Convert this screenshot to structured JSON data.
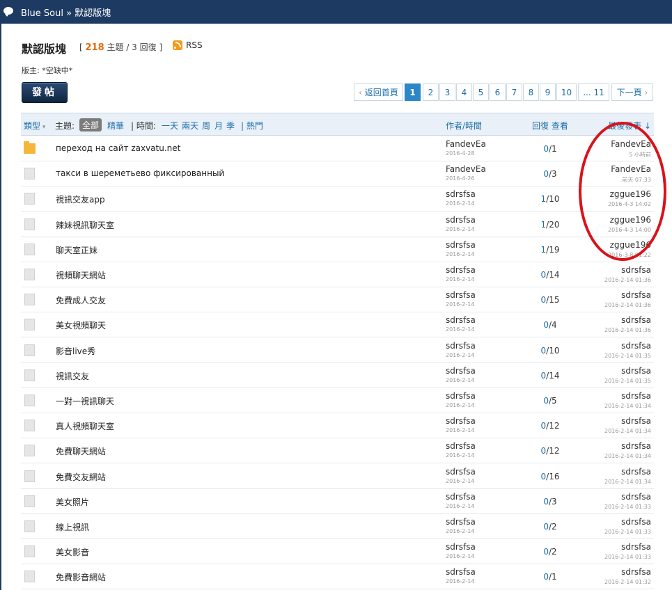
{
  "breadcrumb": {
    "site": "Blue Soul",
    "sep": "»",
    "forum": "默認版塊"
  },
  "forum": {
    "title": "默認版塊",
    "threads": "218",
    "threads_label": "主題",
    "replies": "/ 3 回復",
    "open": "[",
    "close": "]",
    "rss": "RSS"
  },
  "moderator": "版主: *空缺中*",
  "post_button": "發帖",
  "pager": {
    "prev": "返回首頁",
    "pages": [
      "1",
      "2",
      "3",
      "4",
      "5",
      "6",
      "7",
      "8",
      "9",
      "10"
    ],
    "last": "... 11",
    "next": "下一頁",
    "current": "1"
  },
  "header": {
    "type": "類型",
    "subject": "主題:",
    "all": "全部",
    "digest": "精華",
    "time": "| 時間:",
    "day": "一天",
    "two_days": "兩天",
    "week": "周",
    "month": "月",
    "season": "季",
    "hot": "| 熱門",
    "author": "作者/時間",
    "replies_views": "回復 查看",
    "lastpost": "最後發表 ↓"
  },
  "threads": [
    {
      "icon": "folder",
      "subject": "переход на сайт zaxvatu.net",
      "author": "FandevEa",
      "date": "2016-4-28",
      "replies": "0",
      "views": "1",
      "last_user": "FandevEa",
      "last_time": "5 小時前"
    },
    {
      "icon": "file",
      "subject": "такси в шереметьево фиксированный",
      "author": "FandevEa",
      "date": "2016-4-26",
      "replies": "0",
      "views": "3",
      "last_user": "FandevEa",
      "last_time": "前天 07:33"
    },
    {
      "icon": "file",
      "subject": "視訊交友app",
      "author": "sdrsfsa",
      "date": "2016-2-14",
      "replies": "1",
      "views": "10",
      "last_user": "zggue196",
      "last_time": "2016-4-3 14:02"
    },
    {
      "icon": "file",
      "subject": "辣妹視訊聊天室",
      "author": "sdrsfsa",
      "date": "2016-2-14",
      "replies": "1",
      "views": "20",
      "last_user": "zggue196",
      "last_time": "2016-4-3 14:00"
    },
    {
      "icon": "file",
      "subject": "聊天室正妹",
      "author": "sdrsfsa",
      "date": "2016-2-14",
      "replies": "1",
      "views": "19",
      "last_user": "zggue196",
      "last_time": "2016-3-8 01:22"
    },
    {
      "icon": "file",
      "subject": "視頻聊天網站",
      "author": "sdrsfsa",
      "date": "2016-2-14",
      "replies": "0",
      "views": "14",
      "last_user": "sdrsfsa",
      "last_time": "2016-2-14 01:36"
    },
    {
      "icon": "file",
      "subject": "免費成人交友",
      "author": "sdrsfsa",
      "date": "2016-2-14",
      "replies": "0",
      "views": "15",
      "last_user": "sdrsfsa",
      "last_time": "2016-2-14 01:36"
    },
    {
      "icon": "file",
      "subject": "美女視頻聊天",
      "author": "sdrsfsa",
      "date": "2016-2-14",
      "replies": "0",
      "views": "4",
      "last_user": "sdrsfsa",
      "last_time": "2016-2-14 01:36"
    },
    {
      "icon": "file",
      "subject": "影音live秀",
      "author": "sdrsfsa",
      "date": "2016-2-14",
      "replies": "0",
      "views": "10",
      "last_user": "sdrsfsa",
      "last_time": "2016-2-14 01:35"
    },
    {
      "icon": "file",
      "subject": "視訊交友",
      "author": "sdrsfsa",
      "date": "2016-2-14",
      "replies": "0",
      "views": "14",
      "last_user": "sdrsfsa",
      "last_time": "2016-2-14 01:35"
    },
    {
      "icon": "file",
      "subject": "一對一視訊聊天",
      "author": "sdrsfsa",
      "date": "2016-2-14",
      "replies": "0",
      "views": "5",
      "last_user": "sdrsfsa",
      "last_time": "2016-2-14 01:34"
    },
    {
      "icon": "file",
      "subject": "真人視頻聊天室",
      "author": "sdrsfsa",
      "date": "2016-2-14",
      "replies": "0",
      "views": "12",
      "last_user": "sdrsfsa",
      "last_time": "2016-2-14 01:34"
    },
    {
      "icon": "file",
      "subject": "免費聊天網站",
      "author": "sdrsfsa",
      "date": "2016-2-14",
      "replies": "0",
      "views": "12",
      "last_user": "sdrsfsa",
      "last_time": "2016-2-14 01:34"
    },
    {
      "icon": "file",
      "subject": "免費交友網站",
      "author": "sdrsfsa",
      "date": "2016-2-14",
      "replies": "0",
      "views": "16",
      "last_user": "sdrsfsa",
      "last_time": "2016-2-14 01:34"
    },
    {
      "icon": "file",
      "subject": "美女照片",
      "author": "sdrsfsa",
      "date": "2016-2-14",
      "replies": "0",
      "views": "3",
      "last_user": "sdrsfsa",
      "last_time": "2016-2-14 01:33"
    },
    {
      "icon": "file",
      "subject": "線上視訊",
      "author": "sdrsfsa",
      "date": "2016-2-14",
      "replies": "0",
      "views": "2",
      "last_user": "sdrsfsa",
      "last_time": "2016-2-14 01:33"
    },
    {
      "icon": "file",
      "subject": "美女影音",
      "author": "sdrsfsa",
      "date": "2016-2-14",
      "replies": "0",
      "views": "2",
      "last_user": "sdrsfsa",
      "last_time": "2016-2-14 01:33"
    },
    {
      "icon": "file",
      "subject": "免費影音網站",
      "author": "sdrsfsa",
      "date": "2016-2-14",
      "replies": "0",
      "views": "1",
      "last_user": "sdrsfsa",
      "last_time": "2016-2-14 01:32"
    }
  ],
  "colors": {
    "topbar": "#1d3a63",
    "accent": "#2b87c6",
    "link": "#1b6ea8",
    "count": "#e36b0d",
    "annotation": "#d9121b"
  }
}
